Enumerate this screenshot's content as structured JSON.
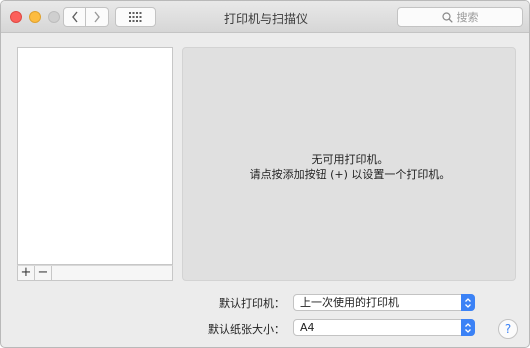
{
  "window": {
    "title": "打印机与扫描仪"
  },
  "toolbar": {
    "search_placeholder": "搜索"
  },
  "list_controls": {
    "add_label": "+",
    "remove_label": "−"
  },
  "empty_state": {
    "line1": "无可用打印机。",
    "line2": "请点按添加按钮 (+) 以设置一个打印机。"
  },
  "settings": {
    "default_printer_label": "默认打印机：",
    "default_printer_value": "上一次使用的打印机",
    "paper_size_label": "默认纸张大小：",
    "paper_size_value": "A4"
  },
  "help": {
    "label": "?"
  },
  "colors": {
    "close": "#fc605b",
    "minimize": "#fdbc40",
    "accent": "#3b82f6"
  },
  "icons": {
    "back": "chevron-left-icon",
    "forward": "chevron-right-icon",
    "grid": "grid-icon",
    "search": "search-icon",
    "stepper": "updown-chevron-icon"
  }
}
